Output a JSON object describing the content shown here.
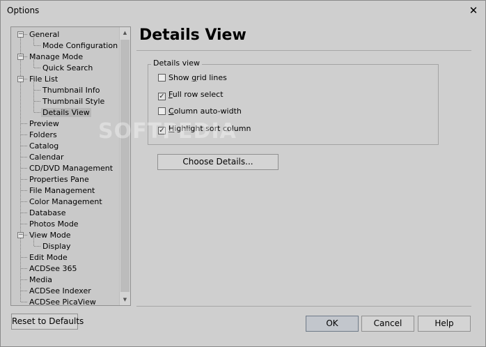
{
  "window": {
    "title": "Options",
    "close_symbol": "✕"
  },
  "tree": {
    "expand_symbol": "−",
    "items": [
      {
        "label": "General",
        "level": 0,
        "expandable": true
      },
      {
        "label": "Mode Configuration",
        "level": 1
      },
      {
        "label": "Manage Mode",
        "level": 0,
        "expandable": true
      },
      {
        "label": "Quick Search",
        "level": 1
      },
      {
        "label": "File List",
        "level": 0,
        "expandable": true
      },
      {
        "label": "Thumbnail Info",
        "level": 1
      },
      {
        "label": "Thumbnail Style",
        "level": 1
      },
      {
        "label": "Details View",
        "level": 1,
        "selected": true
      },
      {
        "label": "Preview",
        "level": 0
      },
      {
        "label": "Folders",
        "level": 0
      },
      {
        "label": "Catalog",
        "level": 0
      },
      {
        "label": "Calendar",
        "level": 0
      },
      {
        "label": "CD/DVD Management",
        "level": 0
      },
      {
        "label": "Properties Pane",
        "level": 0
      },
      {
        "label": "File Management",
        "level": 0
      },
      {
        "label": "Color Management",
        "level": 0
      },
      {
        "label": "Database",
        "level": 0
      },
      {
        "label": "Photos Mode",
        "level": 0
      },
      {
        "label": "View Mode",
        "level": 0,
        "expandable": true
      },
      {
        "label": "Display",
        "level": 1
      },
      {
        "label": "Edit Mode",
        "level": 0
      },
      {
        "label": "ACDSee 365",
        "level": 0
      },
      {
        "label": "Media",
        "level": 0
      },
      {
        "label": "ACDSee Indexer",
        "level": 0
      },
      {
        "label": "ACDSee PicaView",
        "level": 0
      }
    ],
    "scroll_up_symbol": "▲",
    "scroll_down_symbol": "▼"
  },
  "panel": {
    "title": "Details View",
    "group_label": "Details view",
    "options": [
      {
        "pre": "Show ",
        "ul": "g",
        "post": "rid lines",
        "checked": false
      },
      {
        "pre": "",
        "ul": "F",
        "post": "ull row select",
        "checked": true
      },
      {
        "pre": "",
        "ul": "C",
        "post": "olumn auto-width",
        "checked": false
      },
      {
        "pre": "",
        "ul": "H",
        "post": "ighlight sort column",
        "checked": true
      }
    ],
    "choose_details_label": "Choose Details...",
    "check_symbol": "✓"
  },
  "footer": {
    "reset_label": "Reset to Defaults",
    "ok_label": "OK",
    "cancel_label": "Cancel",
    "help_label": "Help"
  },
  "watermark": "SOFTPEDIA"
}
